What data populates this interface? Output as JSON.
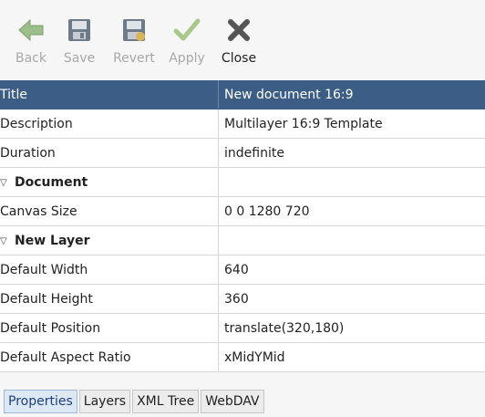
{
  "toolbar": {
    "back": {
      "label": "Back",
      "icon": "back-arrow-icon",
      "enabled": false
    },
    "save": {
      "label": "Save",
      "icon": "floppy-disk-icon",
      "enabled": false
    },
    "revert": {
      "label": "Revert",
      "icon": "revert-floppy-icon",
      "enabled": false
    },
    "apply": {
      "label": "Apply",
      "icon": "checkmark-icon",
      "enabled": false
    },
    "close": {
      "label": "Close",
      "icon": "close-x-icon",
      "enabled": true
    }
  },
  "properties": {
    "header": {
      "key": "Title",
      "value": "New document 16:9"
    },
    "rows": [
      {
        "key": "Description",
        "value": "Multilayer 16:9 Template"
      },
      {
        "key": "Duration",
        "value": "indefinite"
      }
    ],
    "groups": [
      {
        "name": "Document",
        "rows": [
          {
            "key": "Canvas Size",
            "value": "0 0 1280 720"
          }
        ]
      },
      {
        "name": "New Layer",
        "rows": [
          {
            "key": "Default Width",
            "value": "640"
          },
          {
            "key": "Default Height",
            "value": "360"
          },
          {
            "key": "Default Position",
            "value": "translate(320,180)"
          },
          {
            "key": "Default Aspect Ratio",
            "value": "xMidYMid"
          }
        ]
      }
    ]
  },
  "tabs": [
    {
      "label": "Properties",
      "active": true
    },
    {
      "label": "Layers",
      "active": false
    },
    {
      "label": "XML Tree",
      "active": false
    },
    {
      "label": "WebDAV",
      "active": false
    }
  ],
  "colors": {
    "header_bg": "#3b5d86",
    "disabled_text": "#a8a8a8",
    "close_icon": "#555555",
    "apply_icon": "#9bc27a",
    "back_icon": "#8fb27e"
  }
}
